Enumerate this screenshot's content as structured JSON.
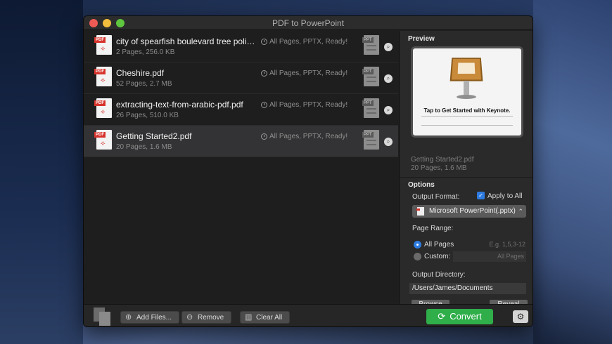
{
  "window": {
    "title": "PDF to PowerPoint"
  },
  "files": [
    {
      "name": "city of spearfish boulevard tree polic...",
      "meta": "2 Pages, 256.0 KB",
      "status": "All Pages, PPTX, Ready!",
      "selected": false
    },
    {
      "name": "Cheshire.pdf",
      "meta": "52 Pages, 2.7 MB",
      "status": "All Pages, PPTX, Ready!",
      "selected": false
    },
    {
      "name": "extracting-text-from-arabic-pdf.pdf",
      "meta": "26 Pages, 510.0 KB",
      "status": "All Pages, PPTX, Ready!",
      "selected": false
    },
    {
      "name": "Getting Started2.pdf",
      "meta": "20 Pages, 1.6 MB",
      "status": "All Pages, PPTX, Ready!",
      "selected": true
    }
  ],
  "icons": {
    "pdf_tag": "PDF",
    "ppt_tag": "PPT"
  },
  "sidebar": {
    "preview_title": "Preview",
    "preview_caption": "Tap to Get Started with Keynote.",
    "preview_name": "Getting Started2.pdf",
    "preview_meta": "20 Pages, 1.6 MB",
    "options_title": "Options",
    "output_format_label": "Output Format:",
    "apply_all_label": "Apply to All",
    "format_value": "Microsoft PowerPoint(.pptx)",
    "page_range_label": "Page Range:",
    "all_pages_label": "All Pages",
    "all_pages_hint": "E.g. 1,5,3-12",
    "custom_label": "Custom:",
    "custom_placeholder": "All Pages",
    "output_dir_label": "Output Directory:",
    "output_dir_value": "/Users/James/Documents",
    "browse_label": "Browse",
    "reveal_label": "Reveal"
  },
  "bottom": {
    "add_files": "Add Files...",
    "remove": "Remove",
    "clear_all": "Clear All",
    "convert": "Convert"
  },
  "colors": {
    "convert_green": "#2fae4a",
    "accent_blue": "#2d7be0",
    "pdf_red": "#d7332c"
  }
}
